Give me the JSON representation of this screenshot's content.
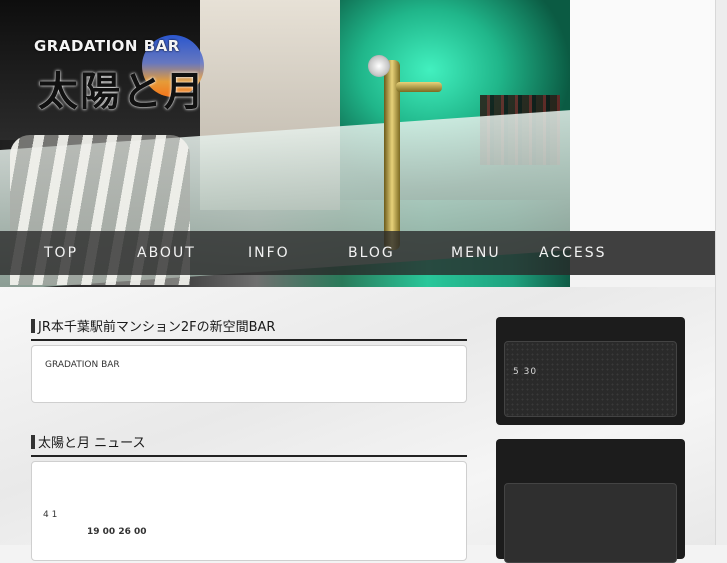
{
  "logo": {
    "subtitle": "GRADATION BAR",
    "name": "太陽と月"
  },
  "nav": {
    "items": [
      "TOP",
      "ABOUT",
      "INFO",
      "BLOG",
      "MENU",
      "ACCESS"
    ]
  },
  "sections": [
    {
      "title": "JR本千葉駅前マンション2Fの新空間BAR",
      "card_text": "GRADATION BAR"
    },
    {
      "title": "太陽と月 ニュース",
      "card_line1": "4 1",
      "card_line2": "19 00 26 00"
    }
  ],
  "sidebar": {
    "box1_text": "5 30"
  }
}
